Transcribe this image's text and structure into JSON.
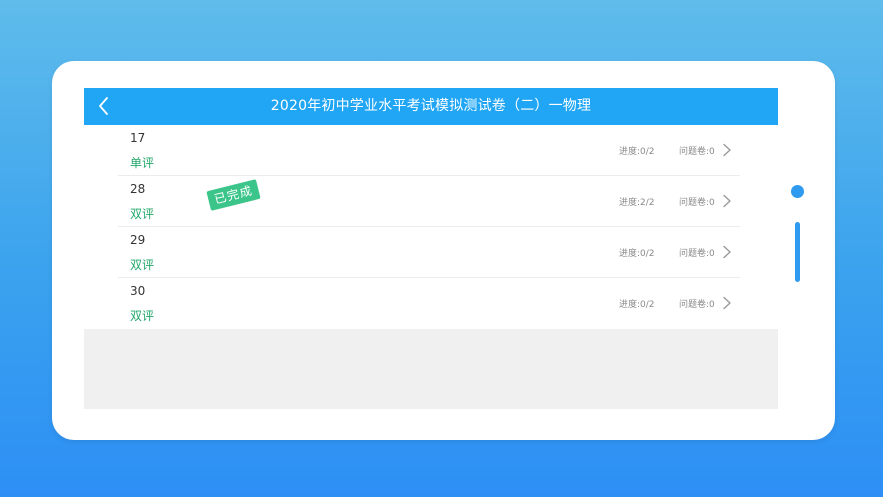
{
  "header": {
    "title": "2020年初中学业水平考试模拟测试卷（二）一物理",
    "back_icon": "chevron-left-icon"
  },
  "colors": {
    "header_bg": "#20a6f5",
    "type_text": "#23a86a",
    "stamp_bg": "#3cc58a",
    "meta_text": "#8a8a8a"
  },
  "rows": [
    {
      "number": "17",
      "type": "单评",
      "progress": "进度:0/2",
      "issues": "问题卷:0",
      "stamp": ""
    },
    {
      "number": "28",
      "type": "双评",
      "progress": "进度:2/2",
      "issues": "问题卷:0",
      "stamp": "已完成"
    },
    {
      "number": "29",
      "type": "双评",
      "progress": "进度:0/2",
      "issues": "问题卷:0",
      "stamp": ""
    },
    {
      "number": "30",
      "type": "双评",
      "progress": "进度:0/2",
      "issues": "问题卷:0",
      "stamp": ""
    }
  ]
}
